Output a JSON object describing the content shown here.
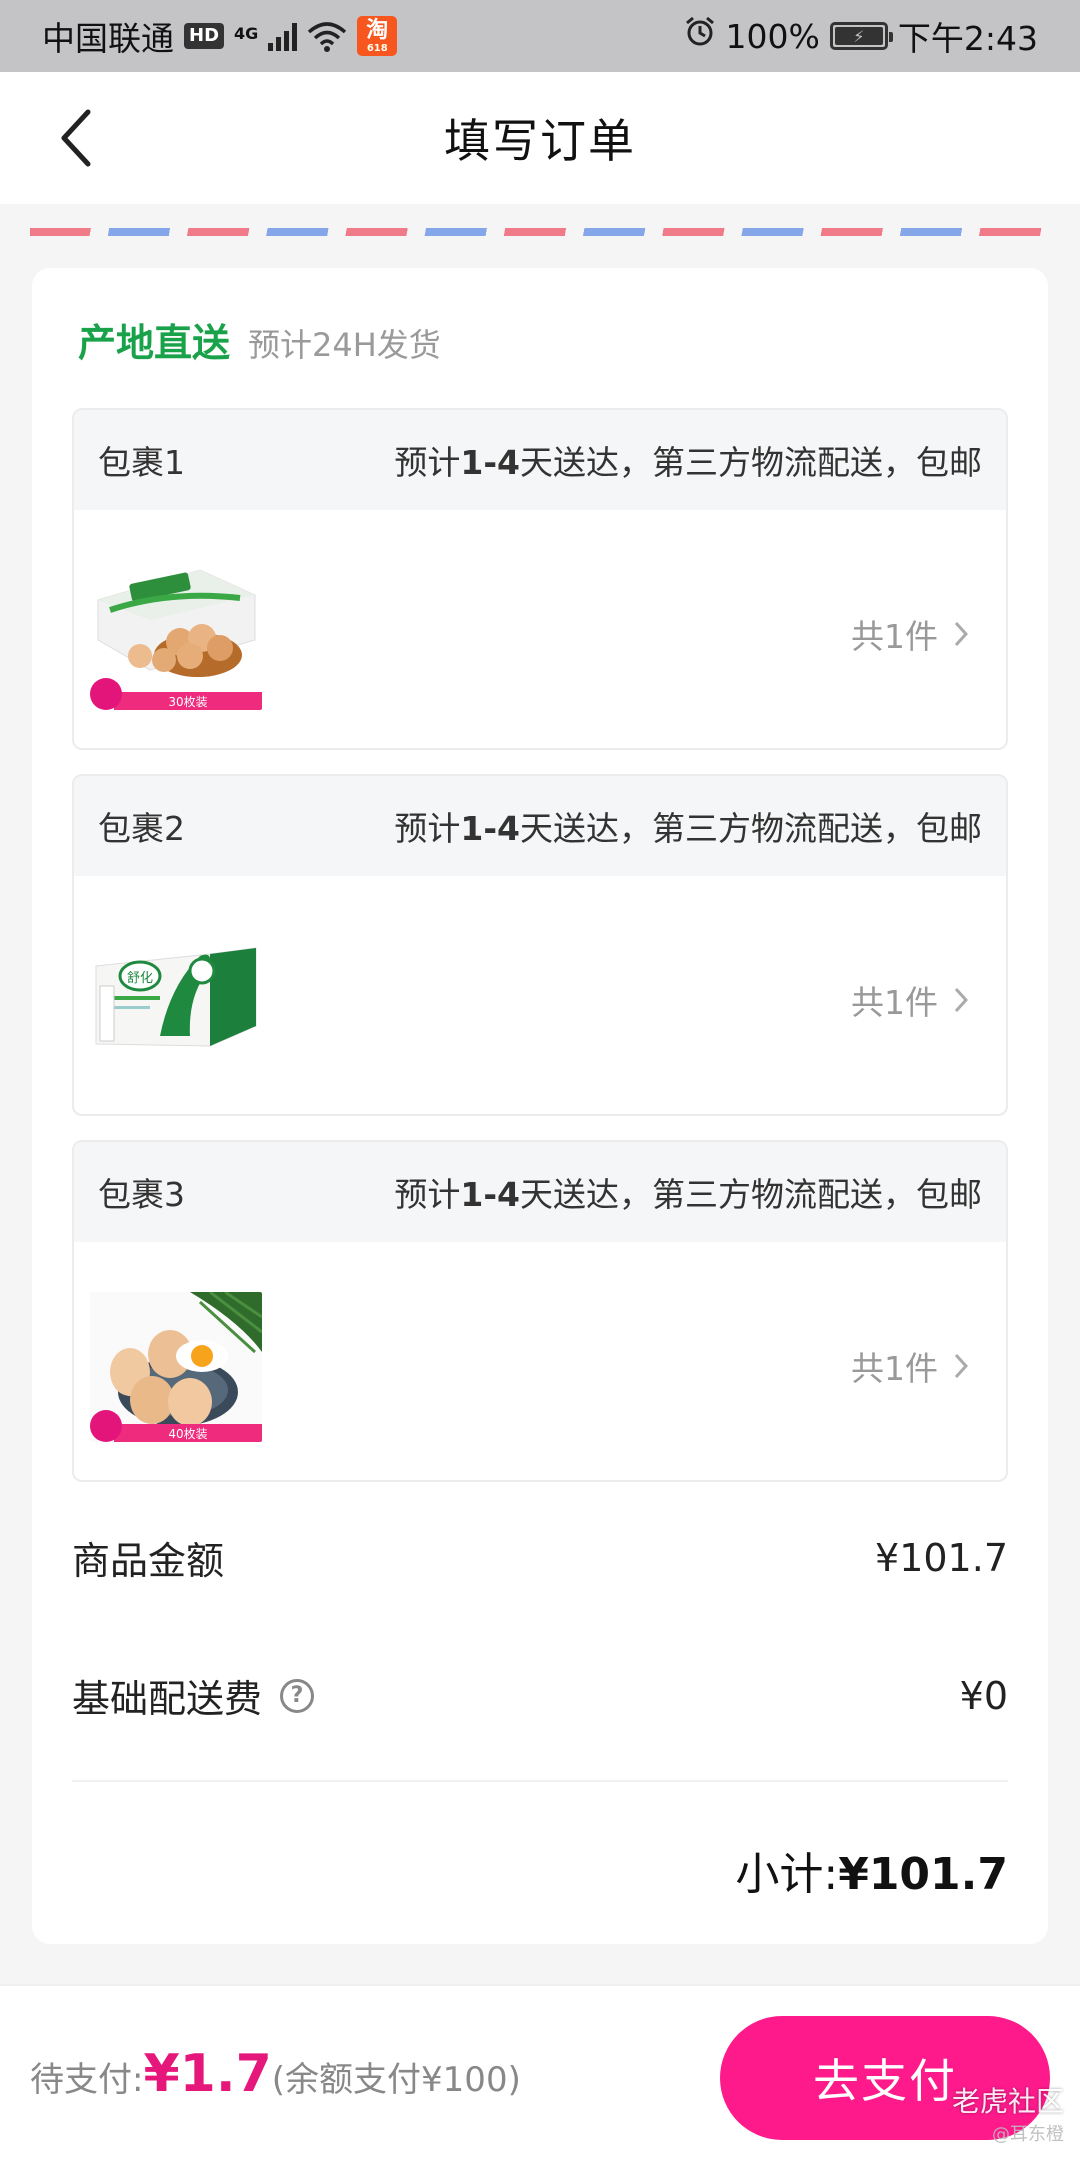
{
  "status_bar": {
    "carrier": "中国联通",
    "hd": "HD",
    "network": "4G",
    "taobao": "淘",
    "taobao_sub": "618",
    "battery": "100%",
    "time": "下午2:43"
  },
  "nav": {
    "title": "填写订单"
  },
  "origin": {
    "title": "产地直送",
    "subtitle": "预计24H发货"
  },
  "packages": [
    {
      "name": "包裹1",
      "delivery_prefix": "预计",
      "delivery_bold": "1-4",
      "delivery_suffix": "天送达，第三方物流配送，包邮",
      "count": "共1件",
      "thumb_label": "30枚装"
    },
    {
      "name": "包裹2",
      "delivery_prefix": "预计",
      "delivery_bold": "1-4",
      "delivery_suffix": "天送达，第三方物流配送，包邮",
      "count": "共1件",
      "thumb_label": "舒化"
    },
    {
      "name": "包裹3",
      "delivery_prefix": "预计",
      "delivery_bold": "1-4",
      "delivery_suffix": "天送达，第三方物流配送，包邮",
      "count": "共1件",
      "thumb_label": "40枚装"
    }
  ],
  "summary": {
    "goods_label": "商品金额",
    "goods_value": "¥101.7",
    "shipping_label": "基础配送费",
    "shipping_value": "¥0",
    "subtotal_label": "小计:",
    "subtotal_value": "¥101.7"
  },
  "bottom": {
    "pay_label": "待支付:",
    "pay_amount": "¥1.7",
    "pay_note": "(余额支付¥100)",
    "pay_button": "去支付"
  },
  "watermark": {
    "text": "老虎社区",
    "sub": "@耳东橙"
  },
  "colors": {
    "accent": "#ff1a8c",
    "green": "#1aa24a"
  }
}
